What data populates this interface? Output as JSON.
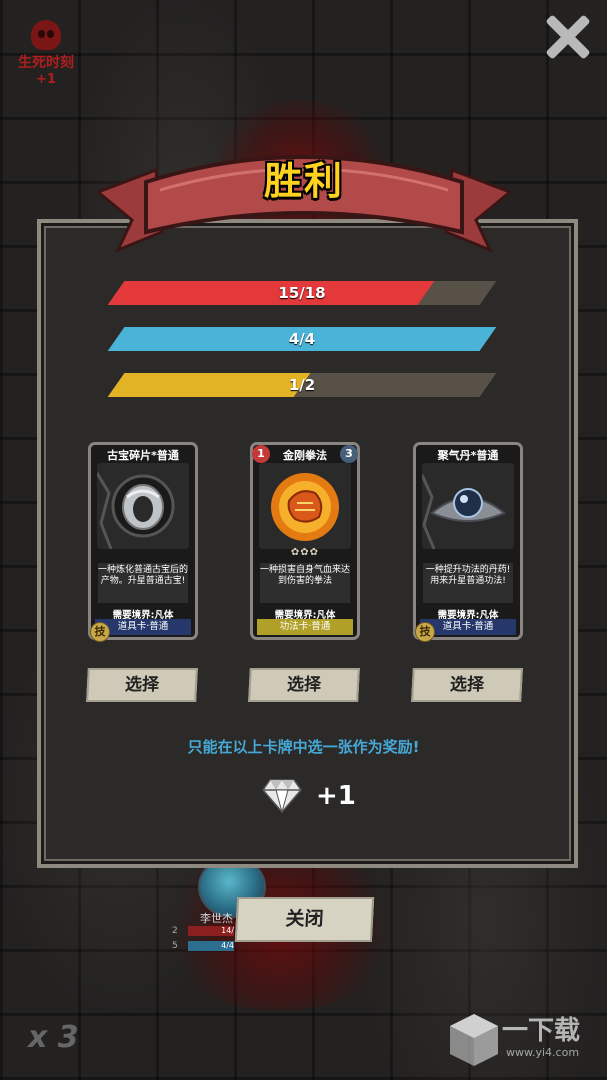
{
  "top_left": {
    "label": "生死时刻",
    "delta": "+1",
    "icon": "skull-icon"
  },
  "close_icon": "close-icon",
  "banner": {
    "title": "胜利"
  },
  "bars": [
    {
      "text": "15/18",
      "fraction": 0.8333,
      "color": "#e4393b"
    },
    {
      "text": "4/4",
      "fraction": 1.0,
      "color": "#49b3d8"
    },
    {
      "text": "1/2",
      "fraction": 0.5,
      "color": "#e1b325"
    }
  ],
  "cards": [
    {
      "title": "古宝碎片*普通",
      "desc": "一种炼化普通古宝后的产物。升星普通古宝!",
      "requirement": "需要境界:凡体",
      "type": "道具卡·普通",
      "type_color": "#26386b",
      "badge": "技"
    },
    {
      "title": "金刚拳法",
      "corner_left": "1",
      "corner_right": "3",
      "stars": "✿✿✿",
      "desc": "一种损害自身气血来达到伤害的拳法",
      "requirement": "需要境界:凡体",
      "type": "功法卡·普通",
      "type_color": "#b1a028"
    },
    {
      "title": "聚气丹*普通",
      "desc": "一种提升功法的丹药! 用来升星普通功法!",
      "requirement": "需要境界:凡体",
      "type": "道具卡·普通",
      "type_color": "#26386b",
      "badge": "技"
    }
  ],
  "select_label": "选择",
  "hint": "只能在以上卡牌中选一张作为奖励!",
  "reward": {
    "icon": "diamond-icon",
    "amount": "+1"
  },
  "background_player": {
    "name": "李世杰",
    "values": [
      "14/",
      "4/4"
    ],
    "left_digits": [
      "2",
      "5"
    ]
  },
  "close_button": "关闭",
  "multiplier": "x 3",
  "watermark": {
    "text": "一下载",
    "url": "www.yi4.com"
  }
}
